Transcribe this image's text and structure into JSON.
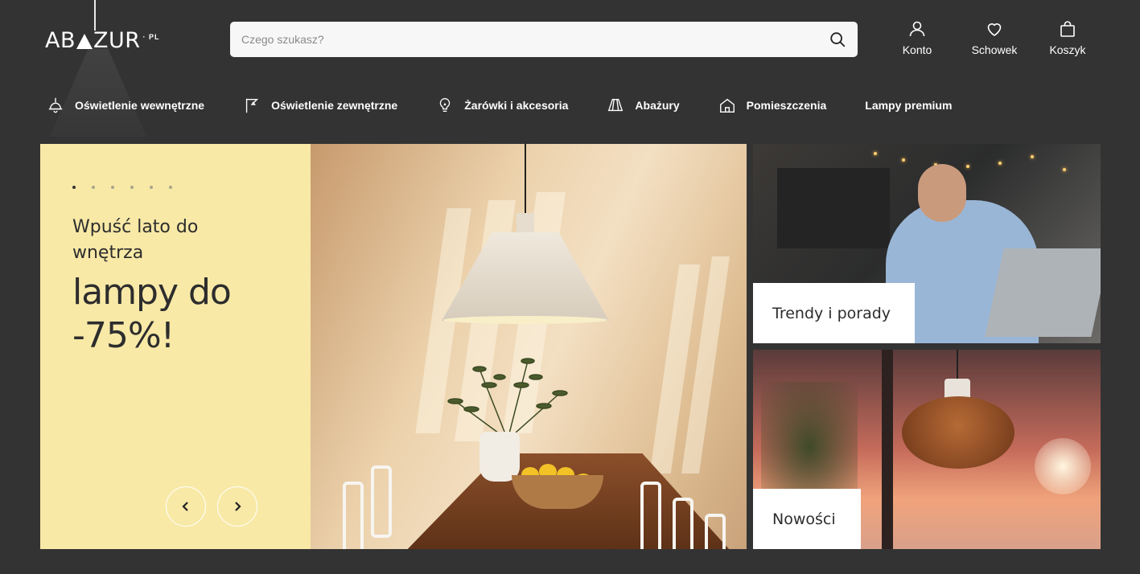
{
  "logo": {
    "text_left": "AB",
    "text_right": "ZUR",
    "suffix": "PL"
  },
  "search": {
    "placeholder": "Czego szukasz?"
  },
  "header_actions": [
    {
      "label": "Konto",
      "icon": "user-icon"
    },
    {
      "label": "Schowek",
      "icon": "heart-icon"
    },
    {
      "label": "Koszyk",
      "icon": "shopping-bag-icon"
    }
  ],
  "nav": [
    {
      "label": "Oświetlenie wewnętrzne",
      "icon": "ceiling-lamp-icon"
    },
    {
      "label": "Oświetlenie zewnętrzne",
      "icon": "outdoor-lamp-icon"
    },
    {
      "label": "Żarówki i akcesoria",
      "icon": "bulb-icon"
    },
    {
      "label": "Abażury",
      "icon": "lampshade-icon"
    },
    {
      "label": "Pomieszczenia",
      "icon": "house-icon"
    },
    {
      "label": "Lampy premium",
      "icon": ""
    }
  ],
  "hero": {
    "subtitle": "Wpuść lato do wnętrza",
    "title": "lampy do -75%!",
    "slide_count": 6,
    "active_slide": 1
  },
  "cards": [
    {
      "label": "Trendy i porady"
    },
    {
      "label": "Nowości"
    }
  ],
  "colors": {
    "background": "#333333",
    "hero_panel": "#f8e9a7",
    "search_bg": "#f7f7f7",
    "card_label_bg": "#ffffff"
  }
}
